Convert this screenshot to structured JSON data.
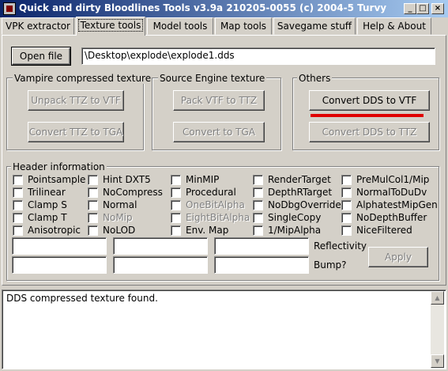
{
  "window": {
    "title": "Quick and dirty Bloodlines Tools v3.9a 210205-0055 (c) 2004-5 Turvy",
    "min": "_",
    "max": "□",
    "close": "×"
  },
  "tabs": [
    "VPK extractor",
    "Texture tools",
    "Model tools",
    "Map tools",
    "Savegame stuff",
    "Help & About"
  ],
  "active_tab": "Texture tools",
  "file": {
    "open_label": "Open file",
    "path": "\\Desktop\\explode\\explode1.dds"
  },
  "groups": {
    "vampire": {
      "title": "Vampire compressed texture",
      "btn1": "Unpack TTZ to VTF",
      "btn2": "Convert TTZ to TGA"
    },
    "source": {
      "title": "Source Engine texture",
      "btn1": "Pack VTF to TTZ",
      "btn2": "Convert to TGA"
    },
    "others": {
      "title": "Others",
      "btn1": "Convert DDS to VTF",
      "btn2": "Convert DDS to TTZ"
    }
  },
  "header": {
    "title": "Header information",
    "col1": [
      "Pointsample",
      "Trilinear",
      "Clamp S",
      "Clamp T",
      "Anisotropic"
    ],
    "col2": [
      "Hint DXT5",
      "NoCompress",
      "Normal",
      "NoMip",
      "NoLOD"
    ],
    "col3": [
      "MinMIP",
      "Procedural",
      "OneBitAlpha",
      "EightBitAlpha",
      "Env. Map"
    ],
    "col4": [
      "RenderTarget",
      "DepthRTarget",
      "NoDbgOverride",
      "SingleCopy",
      "1/MipAlpha"
    ],
    "col5": [
      "PreMulCol1/Mip",
      "NormalToDuDv",
      "AlphatestMipGen",
      "NoDepthBuffer",
      "NiceFiltered"
    ],
    "reflectivity_label": "Reflectivity",
    "bump_label": "Bump?",
    "apply_label": "Apply"
  },
  "log": {
    "text": "DDS compressed texture found."
  },
  "colors": {
    "highlight": "#e00000",
    "titlebar": "#0a246a"
  }
}
